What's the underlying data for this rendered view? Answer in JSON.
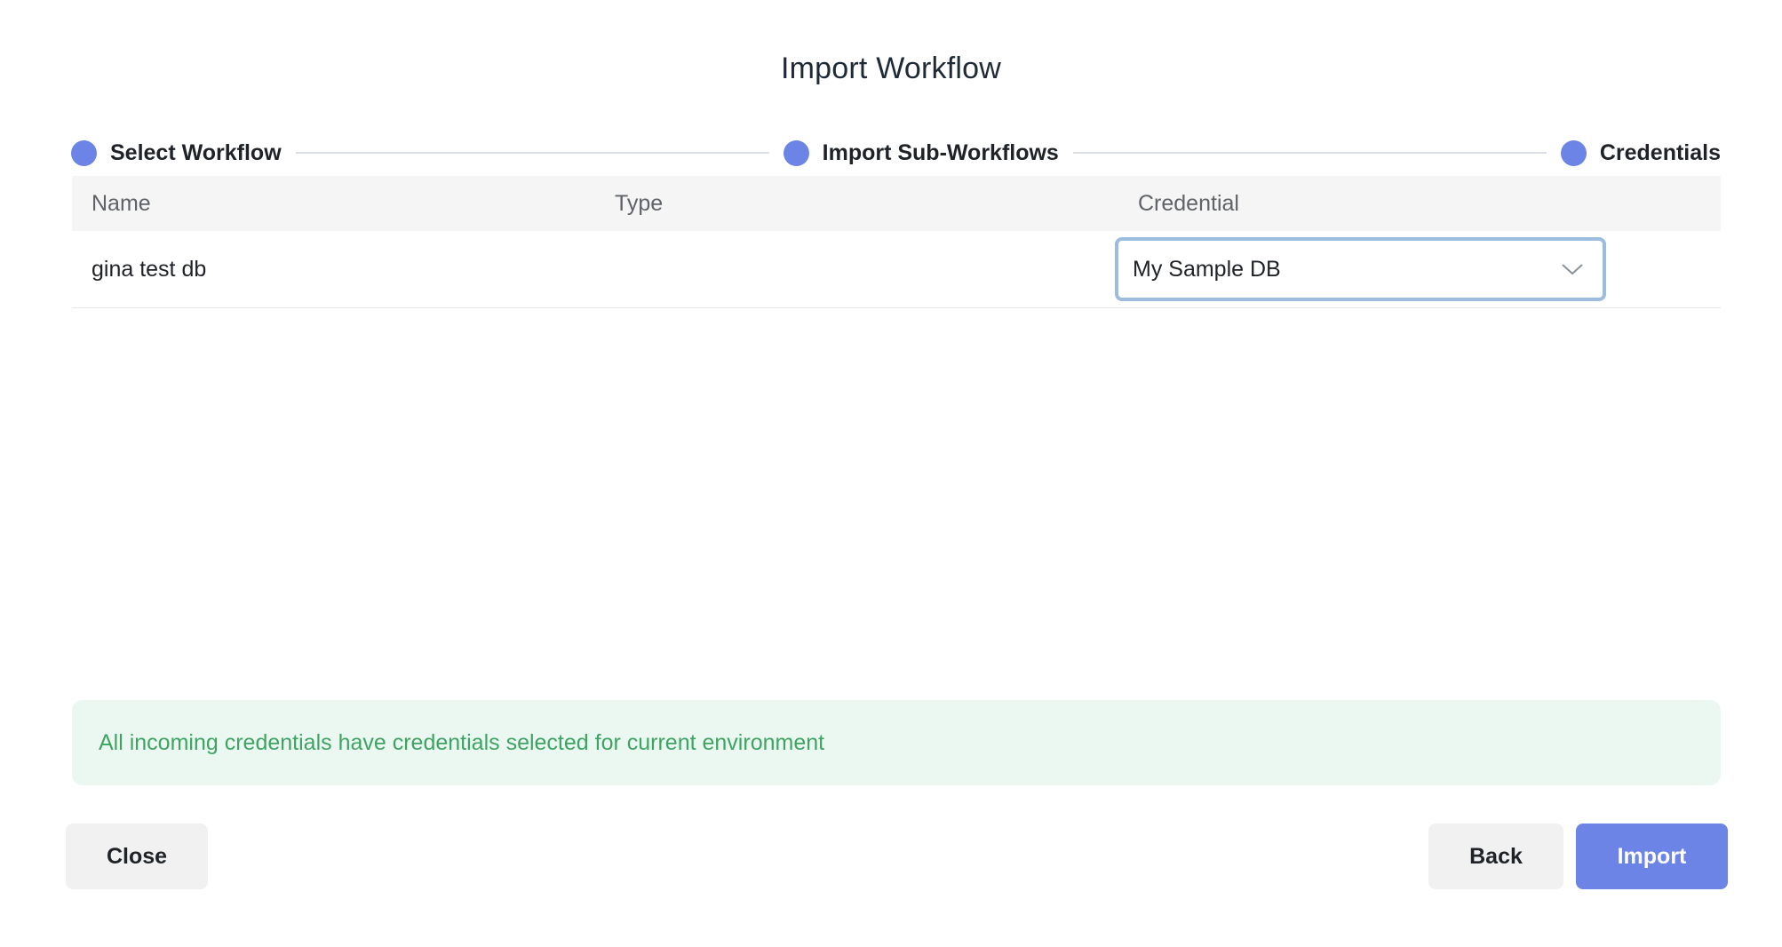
{
  "dialog": {
    "title": "Import Workflow"
  },
  "stepper": {
    "steps": [
      {
        "label": "Select Workflow"
      },
      {
        "label": "Import Sub-Workflows"
      },
      {
        "label": "Credentials"
      }
    ],
    "accent_color": "#6b84e6"
  },
  "table": {
    "headers": {
      "name": "Name",
      "type": "Type",
      "credential": "Credential"
    },
    "rows": [
      {
        "name": "gina test db",
        "type": "",
        "credential_selected": "My Sample DB"
      }
    ]
  },
  "alert": {
    "message": "All incoming credentials have credentials selected for current environment",
    "color": "#3fa463"
  },
  "footer": {
    "close_label": "Close",
    "back_label": "Back",
    "import_label": "Import"
  },
  "icons": {
    "select_chevron": "chevron-down-icon"
  }
}
